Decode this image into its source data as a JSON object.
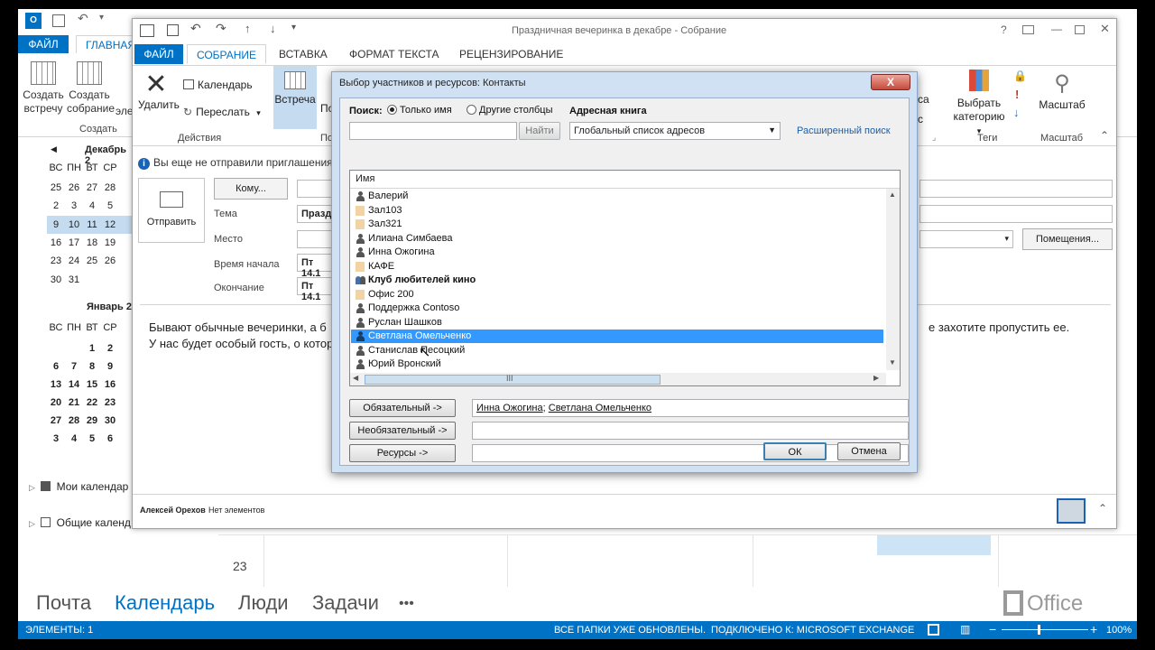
{
  "outer": {
    "tabs": {
      "file": "ФАЙЛ",
      "home": "ГЛАВНАЯ"
    },
    "ribbon": {
      "new_meeting": "Создать встречу",
      "new_assembly": "Создать собрание",
      "group_create": "Создать",
      "cut_label": "эле"
    },
    "mini_cal": {
      "month1": "Декабрь 2",
      "month2": "Январь 2",
      "weekdays": [
        "ВС",
        "ПН",
        "ВТ",
        "СР"
      ],
      "weeks1": [
        [
          "25",
          "26",
          "27",
          "28"
        ],
        [
          "2",
          "3",
          "4",
          "5"
        ],
        [
          "9",
          "10",
          "11",
          "12"
        ],
        [
          "16",
          "17",
          "18",
          "19"
        ],
        [
          "23",
          "24",
          "25",
          "26"
        ],
        [
          "30",
          "31",
          "",
          ""
        ]
      ],
      "weeks2": [
        [
          "",
          "",
          "1",
          "2"
        ],
        [
          "6",
          "7",
          "8",
          "9"
        ],
        [
          "13",
          "14",
          "15",
          "16"
        ],
        [
          "20",
          "21",
          "22",
          "23"
        ],
        [
          "27",
          "28",
          "29",
          "30"
        ],
        [
          "3",
          "4",
          "5",
          "6"
        ]
      ]
    },
    "folders": {
      "my_calendars": "Мои календар",
      "shared_calendars": "Общие календ"
    },
    "grid_date": "23",
    "nav": {
      "mail": "Почта",
      "calendar": "Календарь",
      "people": "Люди",
      "tasks": "Задачи",
      "more": "•••"
    },
    "office_logo": "Office",
    "status": {
      "items": "ЭЛЕМЕНТЫ: 1",
      "folders_updated": "ВСЕ ПАПКИ УЖЕ ОБНОВЛЕНЫ.",
      "connected": "ПОДКЛЮЧЕНО К: MICROSOFT EXCHANGE",
      "zoom": "100%"
    }
  },
  "meeting": {
    "title": "Праздничная вечеринка в декабре - Собрание",
    "tabs": {
      "file": "ФАЙЛ",
      "meeting": "СОБРАНИЕ",
      "insert": "ВСТАВКА",
      "format": "ФОРМАТ ТЕКСТА",
      "review": "РЕЦЕНЗИРОВАНИЕ"
    },
    "ribbon": {
      "delete": "Удалить",
      "calendar": "Календарь",
      "forward": "Переслать",
      "group_actions": "Действия",
      "meeting_btn": "Встреча",
      "meeting_btn2": "По",
      "group_p": "По",
      "choose_category": "Выбрать категорию",
      "group_tags": "Теги",
      "zoom": "Масштаб",
      "group_zoom": "Масштаб",
      "cut_text": "са"
    },
    "info": "Вы еще не отправили приглашения",
    "send": "Отправить",
    "to": "Кому...",
    "subject_label": "Тема",
    "subject_value": "Празд",
    "location_label": "Место",
    "start_label": "Время начала",
    "start_value": "Пт 14.1",
    "end_label": "Окончание",
    "end_value": "Пт 14.1",
    "rooms": "Помещения...",
    "body_line1_left": "Бывают обычные вечеринки, а б",
    "body_line1_right": "е захотите пропустить ее.",
    "body_line2_left": "У нас будет особый гость, о котор",
    "people_name": "Алексей Орехов",
    "people_items": "Нет элементов"
  },
  "dialog": {
    "title": "Выбор участников и ресурсов: Контакты",
    "close": "X",
    "search_label": "Поиск:",
    "radio_name_only": "Только имя",
    "radio_other_cols": "Другие столбцы",
    "address_book_label": "Адресная книга",
    "find_btn": "Найти",
    "address_book_value": "Глобальный список адресов",
    "advanced_search": "Расширенный поиск",
    "list_header": "Имя",
    "rows": [
      {
        "name": "Валерий",
        "type": "person"
      },
      {
        "name": "Зал103",
        "type": "room"
      },
      {
        "name": "Зал321",
        "type": "room"
      },
      {
        "name": "Илиана Симбаева",
        "type": "person"
      },
      {
        "name": "Инна Ожогина",
        "type": "person"
      },
      {
        "name": "КАФЕ",
        "type": "room"
      },
      {
        "name": "Клуб любителей кино",
        "type": "group"
      },
      {
        "name": "Офис 200",
        "type": "room"
      },
      {
        "name": "Поддержка Contoso",
        "type": "person"
      },
      {
        "name": "Руслан Шашков",
        "type": "person"
      },
      {
        "name": "Светлана Омельченко",
        "type": "person",
        "selected": true
      },
      {
        "name": "Станислав Песоцкий",
        "type": "person"
      },
      {
        "name": "Юрий Вронский",
        "type": "person"
      }
    ],
    "hscroll_grip": "III",
    "required_btn": "Обязательный ->",
    "required_value_1": "Инна Ожогина",
    "required_sep": "; ",
    "required_value_2": "Светлана Омельченко",
    "optional_btn": "Необязательный ->",
    "resources_btn": "Ресурсы ->",
    "ok": "ОК",
    "cancel": "Отмена"
  },
  "colors": {
    "accent": "#0072c6",
    "selection": "#3399ff",
    "dialog_frame": "#cfe1f3"
  }
}
